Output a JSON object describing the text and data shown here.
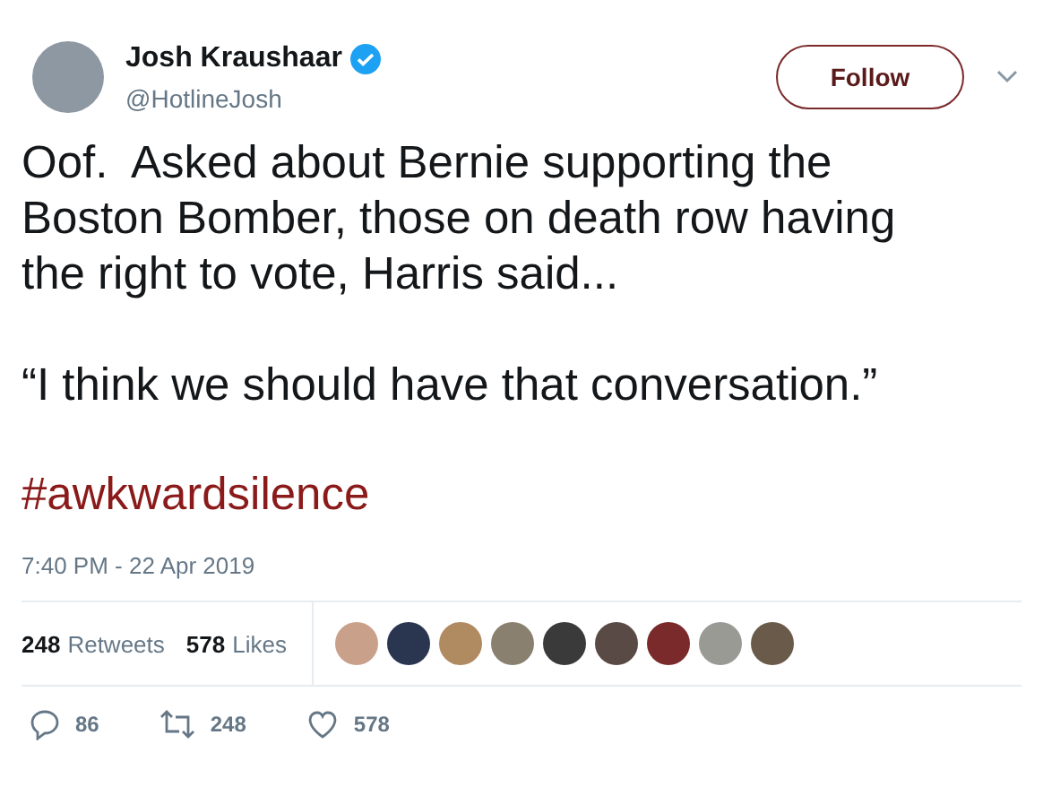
{
  "author": {
    "name": "Josh Kraushaar",
    "verified": true,
    "handle": "@HotlineJosh"
  },
  "follow_button": "Follow",
  "paragraphs": [
    "Oof.  Asked about Bernie supporting the Boston Bomber, those on death row having the right to vote, Harris said...",
    "“I think we should have that conversation.”"
  ],
  "hashtag": "#awkwardsilence",
  "timestamp": "7:40 PM - 22 Apr 2019",
  "stats": [
    {
      "count": "248",
      "label": "Retweets"
    },
    {
      "count": "578",
      "label": "Likes"
    }
  ],
  "actions": [
    {
      "kind": "reply",
      "count": "86"
    },
    {
      "kind": "retweet",
      "count": "248"
    },
    {
      "kind": "like",
      "count": "578"
    }
  ]
}
